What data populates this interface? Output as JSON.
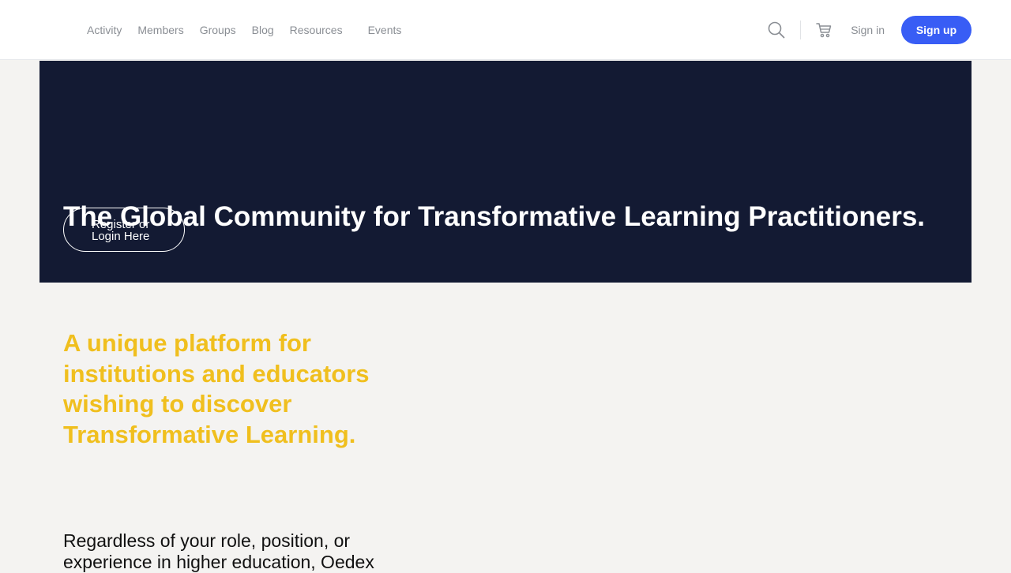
{
  "header": {
    "nav": [
      "Activity",
      "Members",
      "Groups",
      "Blog",
      "Resources",
      "Events"
    ],
    "icons": [
      "search-icon",
      "cart-icon"
    ],
    "signin_label": "Sign in",
    "signup_label": "Sign up",
    "accent_color": "#385df5"
  },
  "hero": {
    "title": "The Global Community for Transformative Learning Practitioners.",
    "cta_line1": "Register or",
    "cta_line2": "Login Here",
    "background_color": "#131a33"
  },
  "content": {
    "tagline": "A unique platform for institutions and educators wishing to discover Transformative Learning.",
    "tagline_color": "#f0bf1e",
    "intro": "Regardless of your role, position, or experience in higher education, Oedex"
  }
}
